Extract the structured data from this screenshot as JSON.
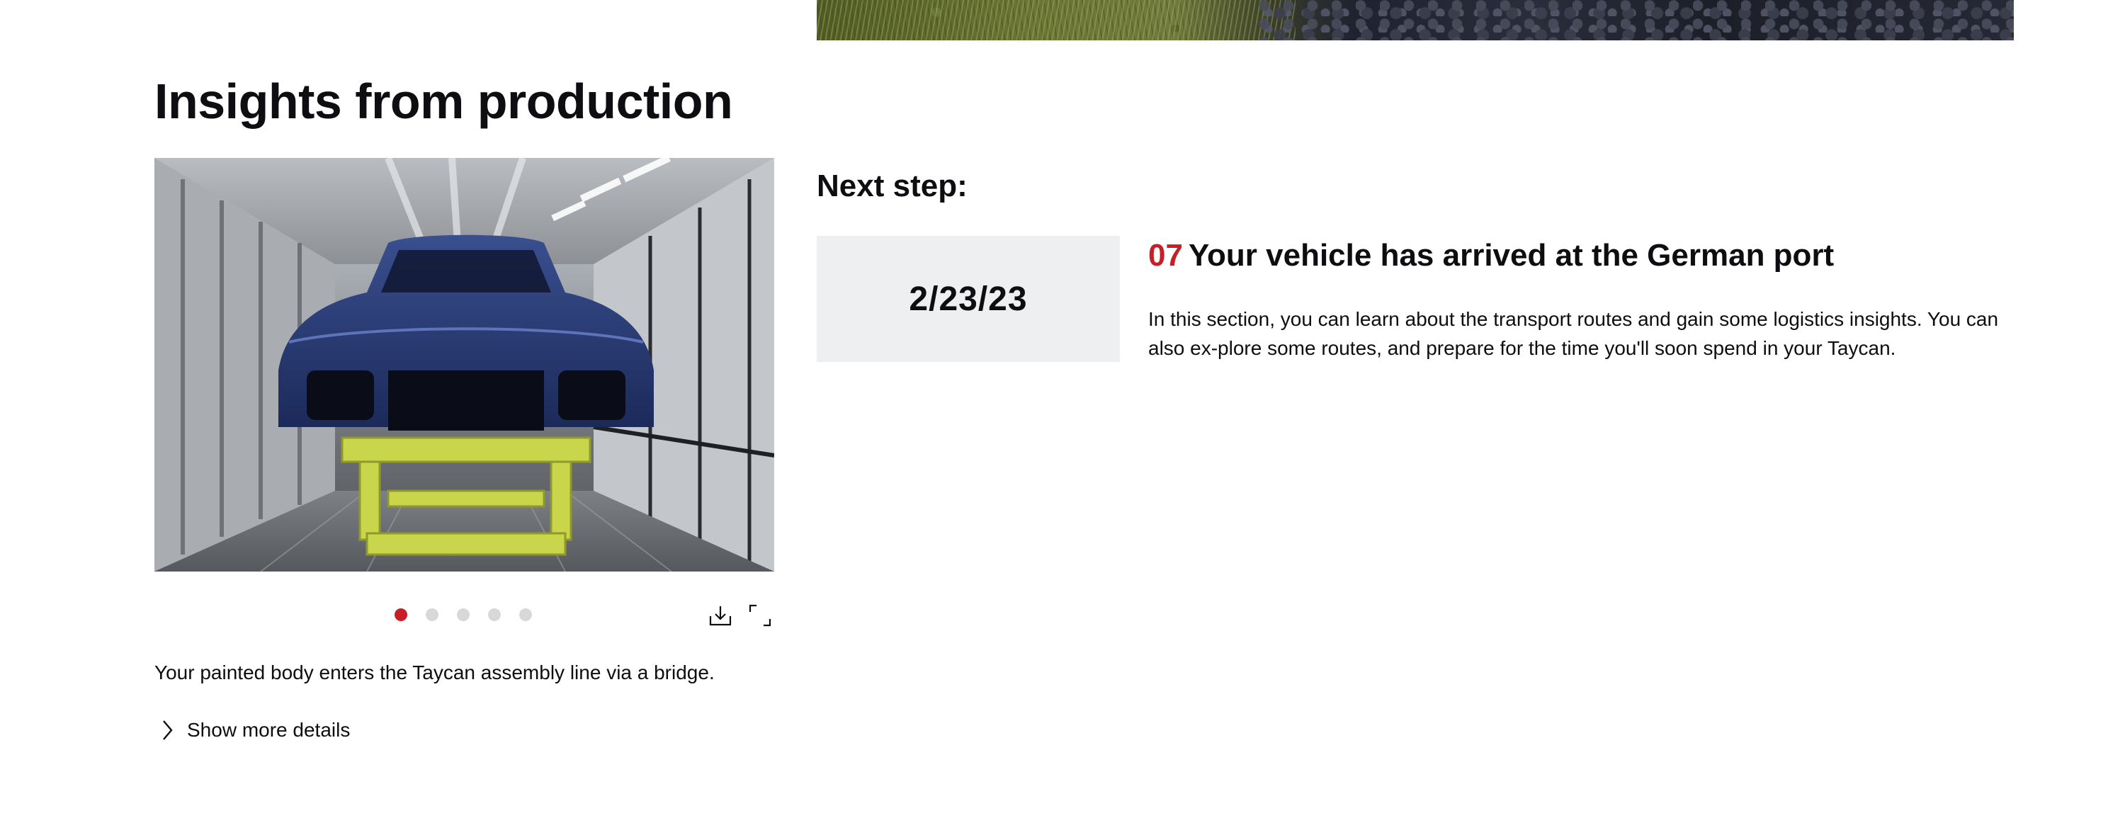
{
  "section": {
    "title": "Insights from production"
  },
  "gallery": {
    "caption": "Your painted body enters the Taycan assembly line via a bridge.",
    "active_index": 0,
    "slide_count": 5,
    "download_icon": "download-icon",
    "fullscreen_icon": "fullscreen-icon"
  },
  "details_toggle": {
    "label": "Show more details",
    "icon": "chevron-right-icon"
  },
  "next_step": {
    "label": "Next step:",
    "date": "2/23/23",
    "number": "07",
    "title": "Your vehicle has arrived at the German port",
    "description": "In this section, you can learn about the transport routes and gain some logistics insights. You can also ex-plore some routes, and prepare for the time you'll soon spend in your Taycan."
  },
  "colors": {
    "accent": "#c62026",
    "text": "#0e0e12",
    "date_box_bg": "#eeeff1",
    "dot_inactive": "#d8d8da"
  }
}
